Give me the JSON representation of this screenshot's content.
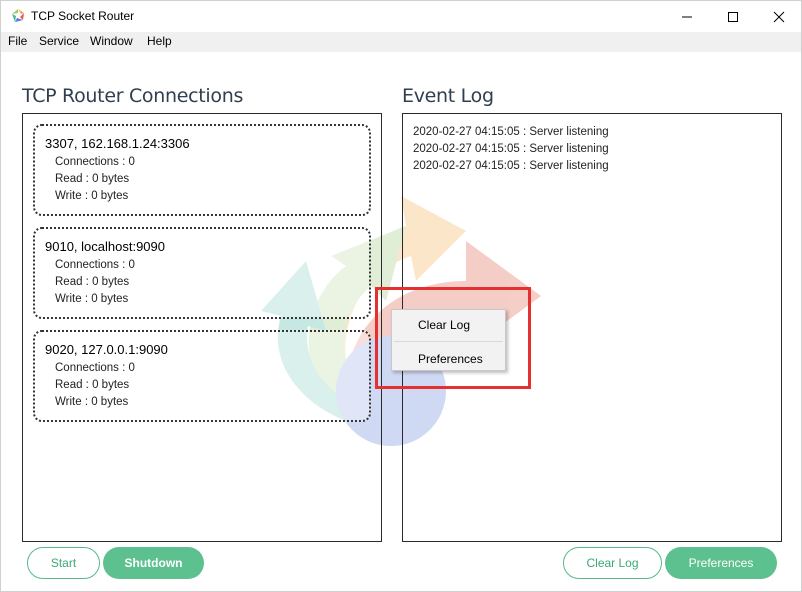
{
  "window": {
    "title": "TCP Socket Router",
    "controls": {
      "minimize": "minimize-icon",
      "maximize": "maximize-icon",
      "close": "close-icon"
    }
  },
  "menu": [
    "File",
    "Service",
    "Window",
    "Help"
  ],
  "connections": {
    "title": "TCP Router Connections",
    "items": [
      {
        "name": "3307, 162.168.1.24:3306",
        "connections": "Connections : 0",
        "read": "Read : 0 bytes",
        "write": "Write : 0 bytes"
      },
      {
        "name": "9010, localhost:9090",
        "connections": "Connections : 0",
        "read": "Read : 0 bytes",
        "write": "Write : 0 bytes"
      },
      {
        "name": "9020, 127.0.0.1:9090",
        "connections": "Connections : 0",
        "read": "Read : 0 bytes",
        "write": "Write : 0 bytes"
      }
    ]
  },
  "event_log": {
    "title": "Event Log",
    "lines": [
      "2020-02-27 04:15:05 : Server listening",
      "2020-02-27 04:15:05 : Server listening",
      "2020-02-27 04:15:05 : Server listening"
    ]
  },
  "context_menu": {
    "items": [
      "Clear Log",
      "Preferences"
    ]
  },
  "buttons": {
    "start": "Start",
    "shutdown": "Shutdown",
    "clear_log": "Clear Log",
    "preferences": "Preferences"
  },
  "colors": {
    "accent": "#5cc08f",
    "highlight": "#e53030"
  }
}
